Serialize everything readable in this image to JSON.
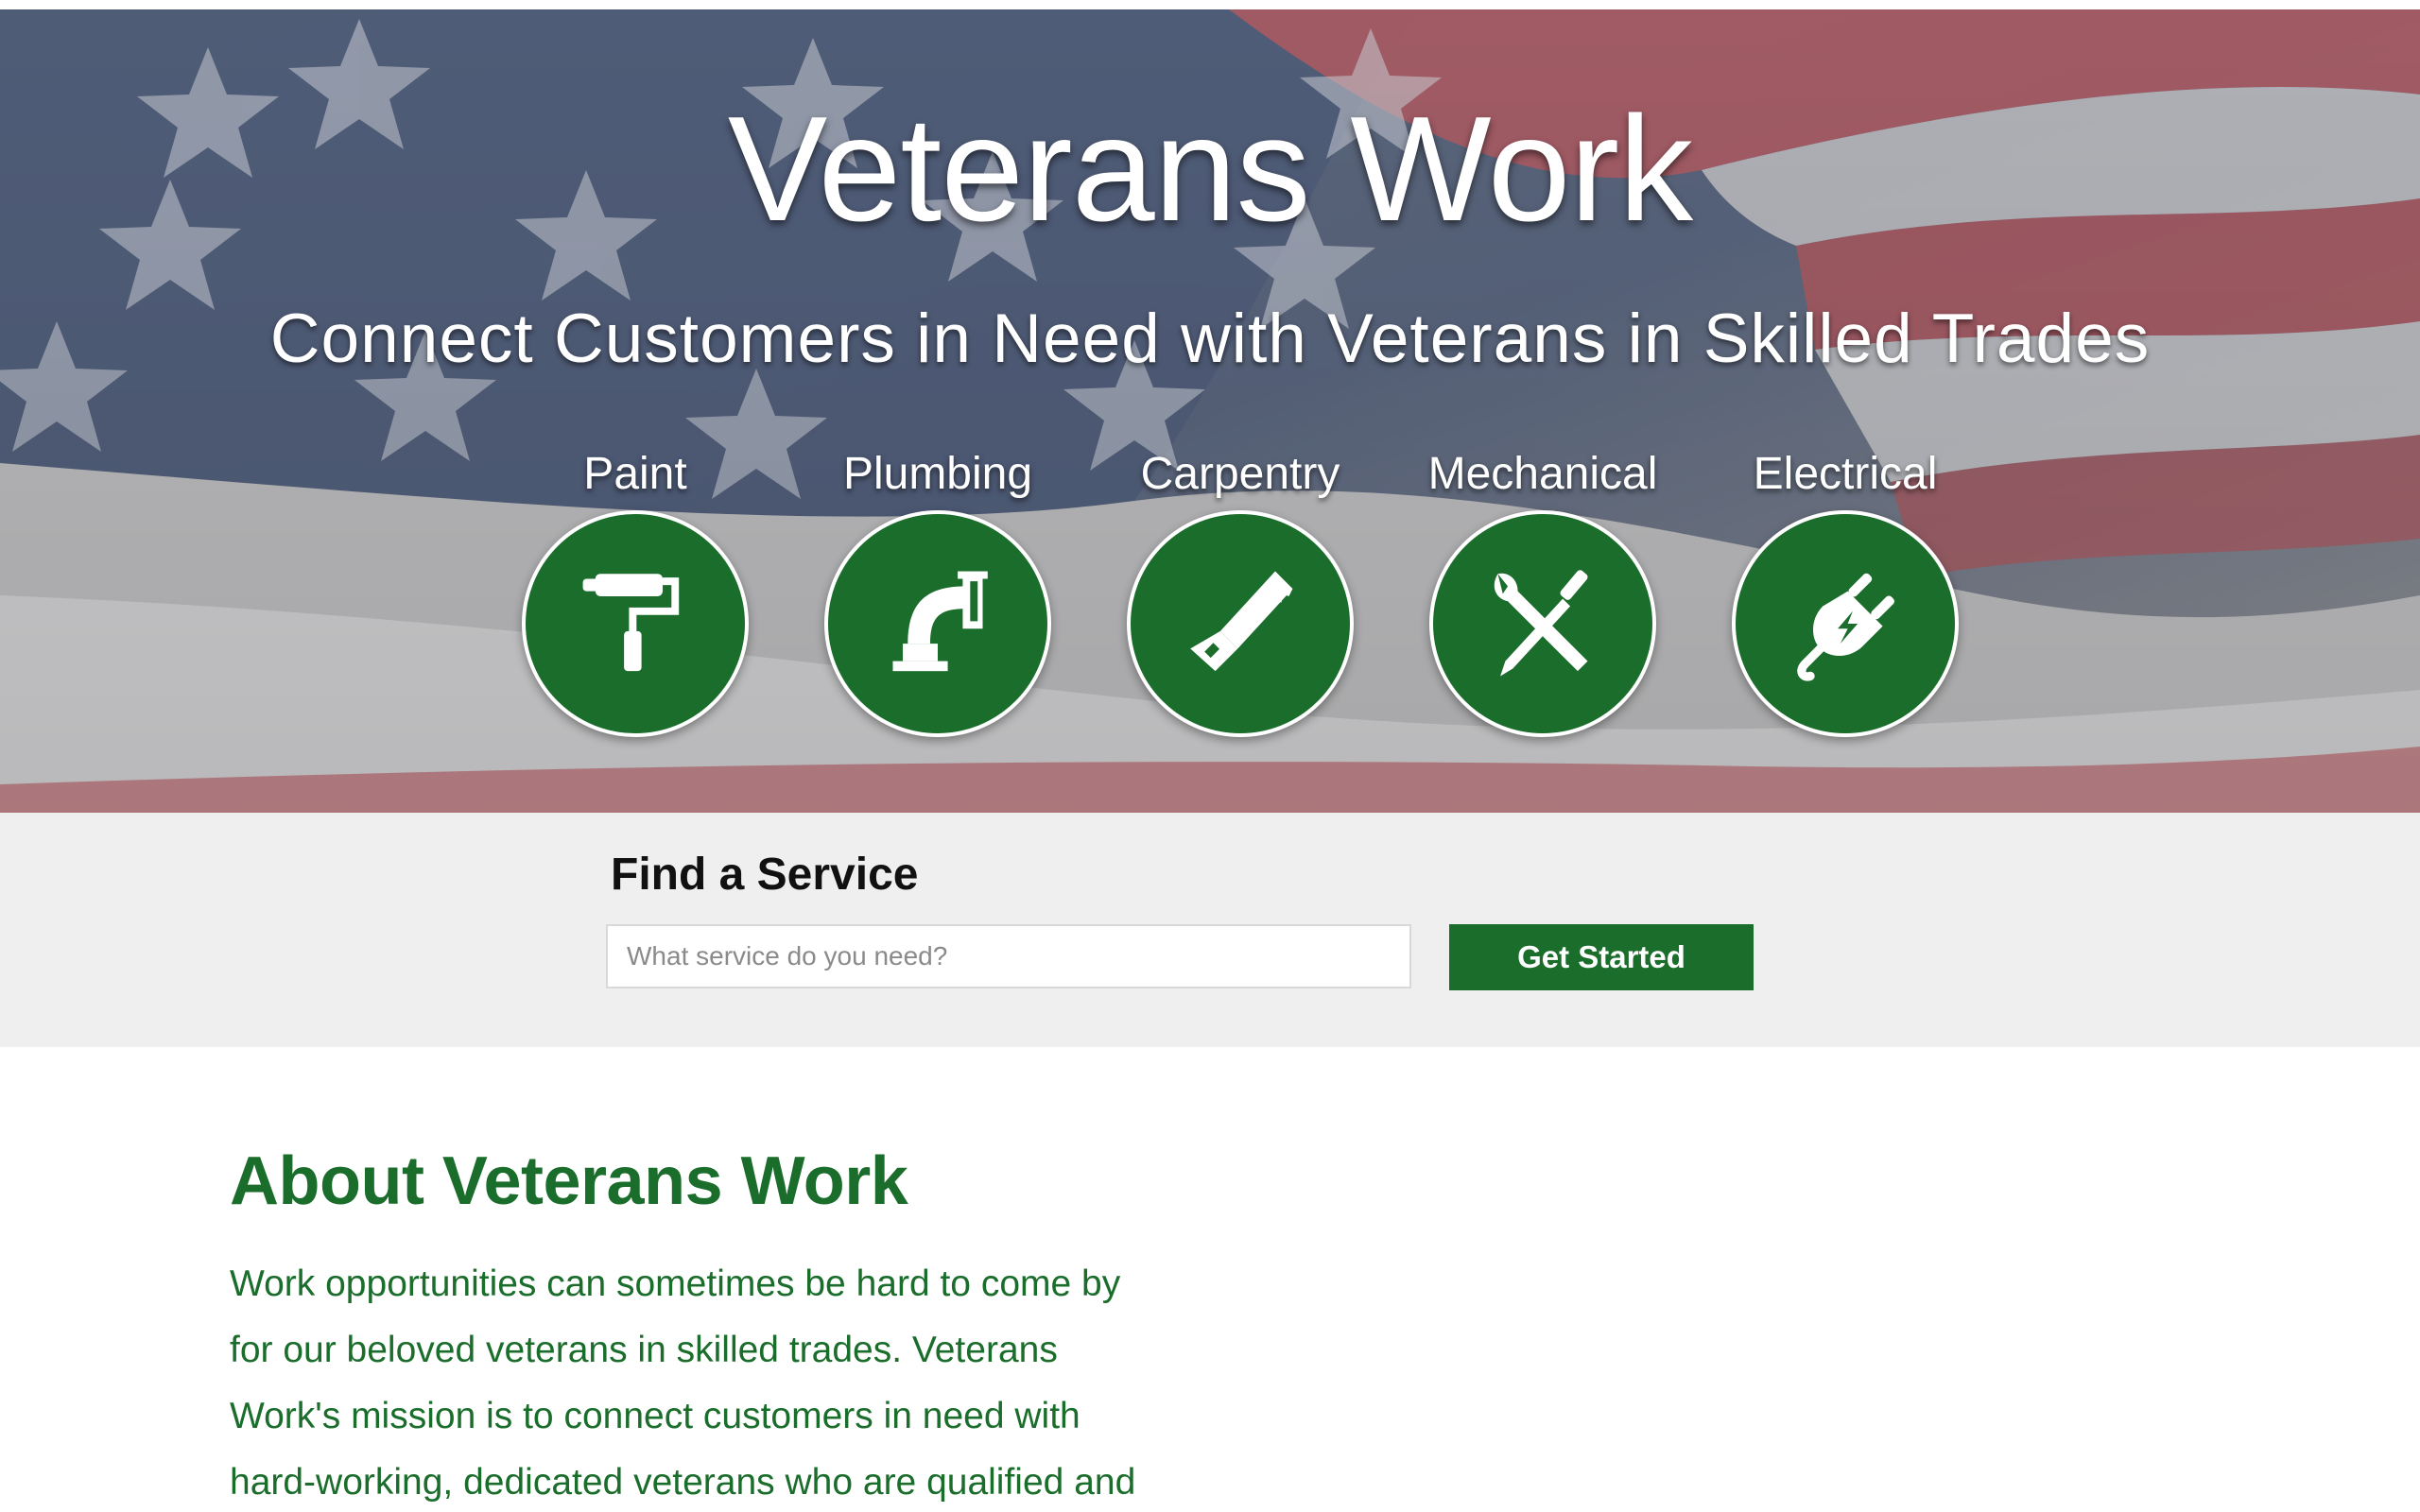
{
  "hero": {
    "title": "Veterans Work",
    "subtitle": "Connect Customers in Need with Veterans in Skilled Trades",
    "services": [
      {
        "label": "Paint",
        "icon": "paint-roller-icon"
      },
      {
        "label": "Plumbing",
        "icon": "pipe-elbow-icon"
      },
      {
        "label": "Carpentry",
        "icon": "saw-icon"
      },
      {
        "label": "Mechanical",
        "icon": "wrench-screwdriver-icon"
      },
      {
        "label": "Electrical",
        "icon": "plug-icon"
      }
    ]
  },
  "find_service": {
    "title": "Find a Service",
    "placeholder": "What service do you need?",
    "button_label": "Get Started"
  },
  "about": {
    "title": "About Veterans Work",
    "body": "Work opportunities can sometimes be hard to come by for our beloved veterans in skilled trades. Veterans Work's mission is to connect customers in need with hard-working, dedicated veterans who are qualified and"
  },
  "colors": {
    "brand_green": "#1b6d2c",
    "band_gray": "#efefef",
    "flag_red": "#b24a50",
    "flag_blue": "#4a5a78"
  }
}
